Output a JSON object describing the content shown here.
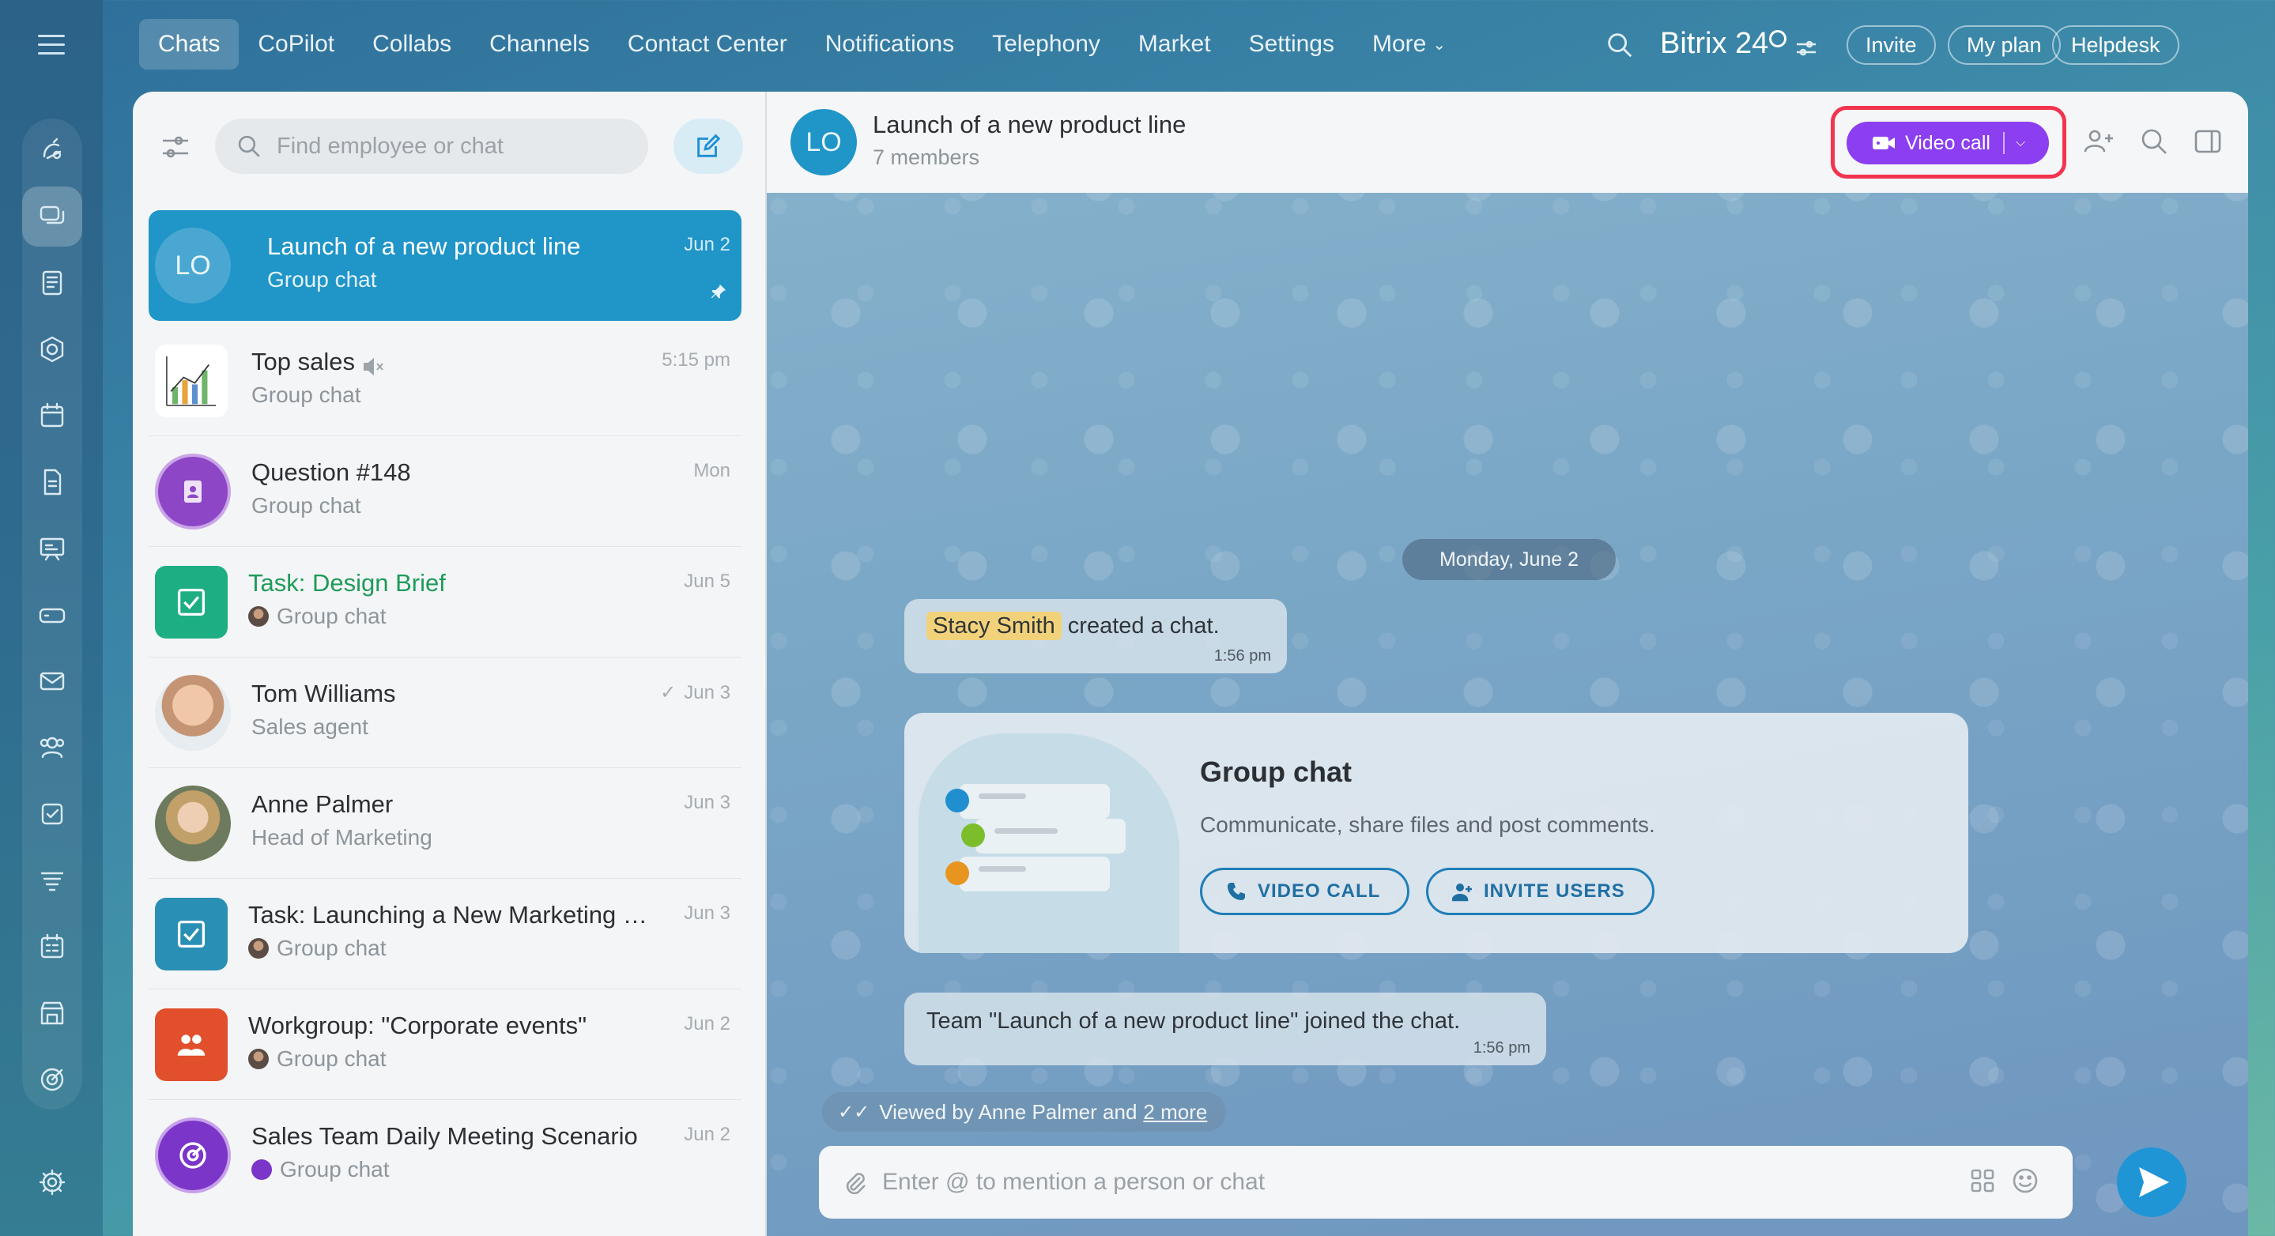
{
  "nav": {
    "items": [
      "Chats",
      "CoPilot",
      "Collabs",
      "Channels",
      "Contact Center",
      "Notifications",
      "Telephony",
      "Market",
      "Settings"
    ],
    "more_label": "More",
    "active": "Chats"
  },
  "brand": {
    "name": "Bitrix 24"
  },
  "top_buttons": {
    "invite": "Invite",
    "my_plan": "My plan",
    "helpdesk": "Helpdesk"
  },
  "list": {
    "search_placeholder": "Find employee or chat",
    "chats": [
      {
        "avatar_text": "LO",
        "title": "Launch of a new product line",
        "subtitle": "Group chat",
        "time": "Jun 2"
      },
      {
        "avatar_text": "",
        "title": "Top sales",
        "subtitle": "Group chat",
        "time": "5:15 pm"
      },
      {
        "avatar_text": "",
        "title": "Question #148",
        "subtitle": "Group chat",
        "time": "Mon"
      },
      {
        "avatar_text": "",
        "title": "Task: Design Brief",
        "subtitle": "Group chat",
        "time": "Jun 5"
      },
      {
        "avatar_text": "",
        "title": "Tom Williams",
        "subtitle": "Sales agent",
        "time": "Jun 3"
      },
      {
        "avatar_text": "",
        "title": "Anne Palmer",
        "subtitle": "Head of Marketing",
        "time": "Jun 3"
      },
      {
        "avatar_text": "",
        "title": "Task: Launching a New Marketing C...",
        "subtitle": "Group chat",
        "time": "Jun 3"
      },
      {
        "avatar_text": "",
        "title": "Workgroup: \"Corporate events\"",
        "subtitle": "Group chat",
        "time": "Jun 2"
      },
      {
        "avatar_text": "",
        "title": "Sales Team Daily Meeting Scenario",
        "subtitle": "Group chat",
        "time": "Jun 2"
      }
    ]
  },
  "chat": {
    "avatar_text": "LO",
    "title": "Launch of a new product line",
    "members": "7 members",
    "video_call_label": "Video call",
    "date_separator": "Monday, June 2",
    "created_user": "Stacy Smith",
    "created_text": "created a chat.",
    "created_time": "1:56 pm",
    "card": {
      "title": "Group chat",
      "description": "Communicate, share files and post comments.",
      "video_call_button": "VIDEO CALL",
      "invite_button": "INVITE USERS"
    },
    "joined_text": "Team \"Launch of a new product line\" joined the chat.",
    "joined_time": "1:56 pm",
    "viewed_prefix": "Viewed by Anne Palmer and",
    "viewed_more": "2 more",
    "input_placeholder": "Enter @ to mention a person or chat"
  },
  "colors": {
    "accent": "#1f95c8",
    "video_button": "#8b3ff0",
    "highlight": "#f2344f",
    "task_title_green": "#1e9b5a"
  }
}
